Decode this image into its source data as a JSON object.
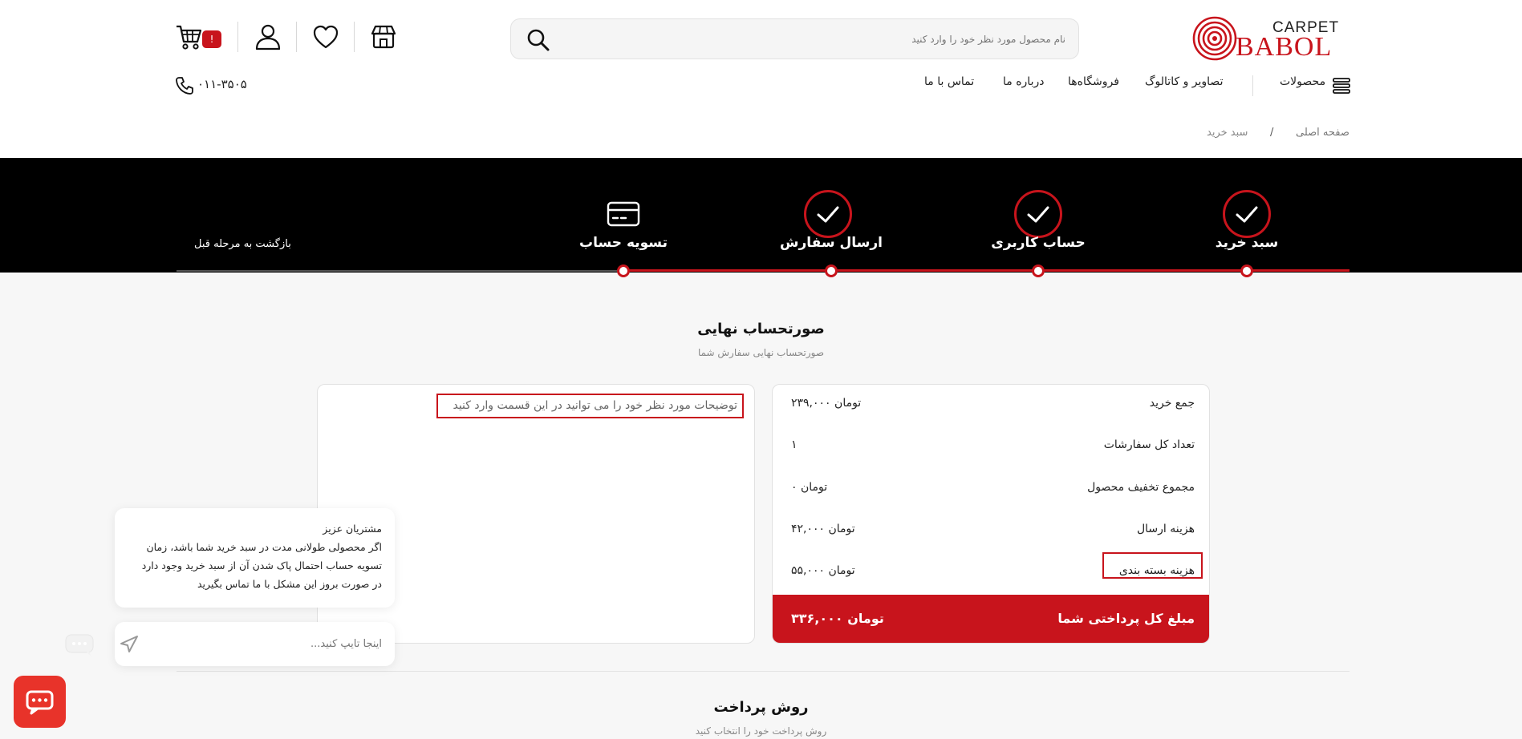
{
  "header": {
    "logo": {
      "carpet": "CARPET",
      "babol": "BABOL"
    },
    "search": {
      "placeholder": "نام محصول مورد نظر خود را وارد کنید"
    },
    "cart_badge": "!",
    "nav": {
      "products": "محصولات",
      "gallery": "تصاویر و کاتالوگ",
      "stores": "فروشگاه‌ها",
      "about": "درباره ما",
      "contact": "تماس با ما"
    },
    "phone": "۰۱۱-۳۵۰۵"
  },
  "breadcrumb": {
    "home": "صفحه اصلی",
    "separator": "/",
    "current": "سبد خرید"
  },
  "stepper": {
    "steps": [
      {
        "label": "سبد خرید",
        "done": true
      },
      {
        "label": "حساب کاربری",
        "done": true
      },
      {
        "label": "ارسال سفارش",
        "done": true
      },
      {
        "label": "تسویه حساب",
        "done": false
      }
    ],
    "back_label": "بازگشت به مرحله قبل"
  },
  "invoice": {
    "title": "صورتحساب نهایی",
    "subtitle": "صورتحساب نهایی سفارش شما",
    "rows": [
      {
        "label": "جمع خرید",
        "value": "۲۳۹,۰۰۰ تومان"
      },
      {
        "label": "تعداد کل سفارشات",
        "value": "۱"
      },
      {
        "label": "مجموع تخفیف محصول",
        "value": "۰ تومان"
      },
      {
        "label": "هزینه ارسال",
        "value": "۴۲,۰۰۰ تومان"
      },
      {
        "label": "هزینه بسته بندی",
        "value": "۵۵,۰۰۰ تومان"
      }
    ],
    "total_label": "مبلغ کل پرداختی شما",
    "total_value": "۳۳۶,۰۰۰ تومان",
    "notes_placeholder": "توضیحات مورد نظر خود را می توانید در این قسمت وارد کنید"
  },
  "payment": {
    "title": "روش پرداخت",
    "subtitle": "روش پرداخت خود را انتخاب کنید"
  },
  "chat": {
    "lines": [
      "مشتریان عزیز",
      "اگر محصولی طولانی مدت در سبد خرید شما باشد، زمان",
      "تسویه حساب احتمال پاک شدن آن از سبد خرید وجود دارد",
      "در صورت بروز این مشکل با ما تماس بگیرید"
    ],
    "input_placeholder": "اینجا تایپ کنید..."
  },
  "colors": {
    "accent": "#c8141c",
    "stepper_bg": "#000000",
    "chat_launcher": "#e8332a"
  }
}
